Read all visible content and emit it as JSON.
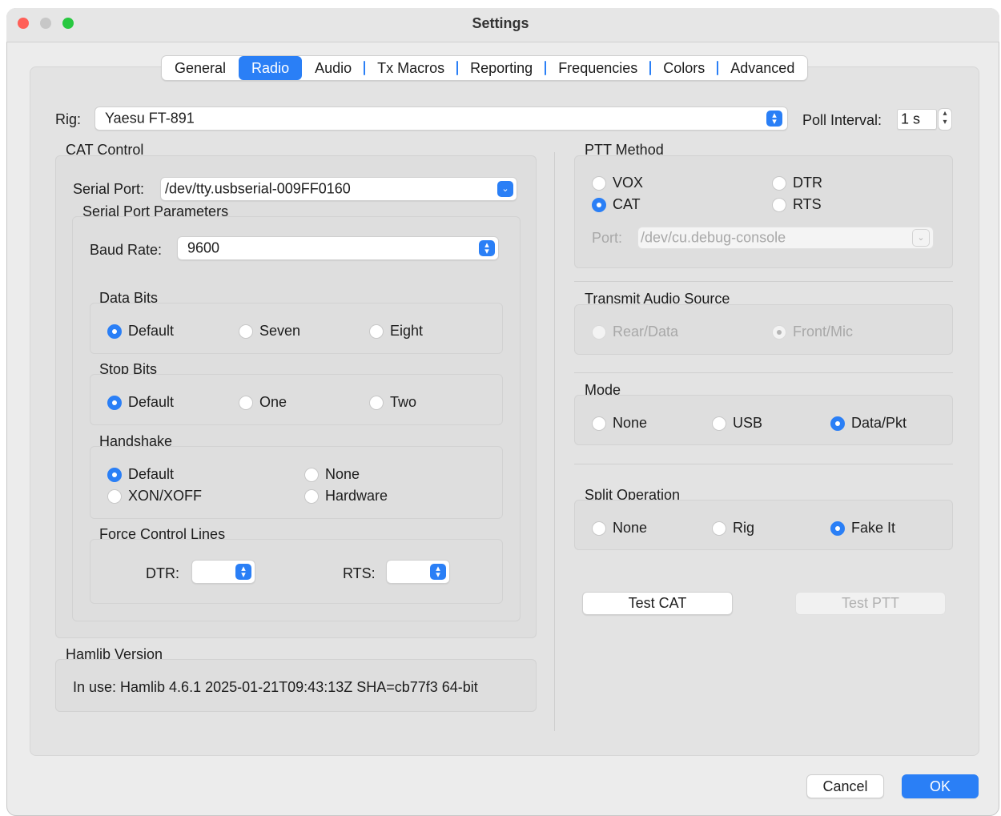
{
  "window": {
    "title": "Settings",
    "traffic_colors": {
      "close": "#ff5f57",
      "minimize": "#c7c7c7",
      "maximize": "#28c840"
    }
  },
  "tabs": [
    {
      "label": "General",
      "selected": false
    },
    {
      "label": "Radio",
      "selected": true
    },
    {
      "label": "Audio",
      "selected": false
    },
    {
      "label": "Tx Macros",
      "selected": false
    },
    {
      "label": "Reporting",
      "selected": false
    },
    {
      "label": "Frequencies",
      "selected": false
    },
    {
      "label": "Colors",
      "selected": false
    },
    {
      "label": "Advanced",
      "selected": false
    }
  ],
  "rig": {
    "label": "Rig:",
    "value": "Yaesu FT-891"
  },
  "poll": {
    "label": "Poll Interval:",
    "value": "1 s"
  },
  "cat": {
    "title": "CAT Control",
    "serial_port_label": "Serial Port:",
    "serial_port_value": "/dev/tty.usbserial-009FF0160",
    "params_title": "Serial Port Parameters",
    "baud_label": "Baud Rate:",
    "baud_value": "9600",
    "data_bits": {
      "title": "Data Bits",
      "options": [
        "Default",
        "Seven",
        "Eight"
      ],
      "selected": "Default"
    },
    "stop_bits": {
      "title": "Stop Bits",
      "options": [
        "Default",
        "One",
        "Two"
      ],
      "selected": "Default"
    },
    "handshake": {
      "title": "Handshake",
      "options": [
        "Default",
        "None",
        "XON/XOFF",
        "Hardware"
      ],
      "selected": "Default"
    },
    "force": {
      "title": "Force Control Lines",
      "dtr_label": "DTR:",
      "rts_label": "RTS:"
    }
  },
  "hamlib": {
    "title": "Hamlib Version",
    "text": "In use:  Hamlib 4.6.1 2025-01-21T09:43:13Z SHA=cb77f3 64-bit"
  },
  "ptt": {
    "title": "PTT Method",
    "options": [
      "VOX",
      "DTR",
      "CAT",
      "RTS"
    ],
    "selected": "CAT",
    "port_label": "Port:",
    "port_value": "/dev/cu.debug-console"
  },
  "tx_audio": {
    "title": "Transmit Audio Source",
    "options": [
      "Rear/Data",
      "Front/Mic"
    ],
    "selected": "Front/Mic"
  },
  "mode": {
    "title": "Mode",
    "options": [
      "None",
      "USB",
      "Data/Pkt"
    ],
    "selected": "Data/Pkt"
  },
  "split": {
    "title": "Split Operation",
    "options": [
      "None",
      "Rig",
      "Fake It"
    ],
    "selected": "Fake It"
  },
  "buttons": {
    "test_cat": "Test CAT",
    "test_ptt": "Test PTT",
    "cancel": "Cancel",
    "ok": "OK"
  },
  "colors": {
    "accent": "#2a7ff6"
  }
}
